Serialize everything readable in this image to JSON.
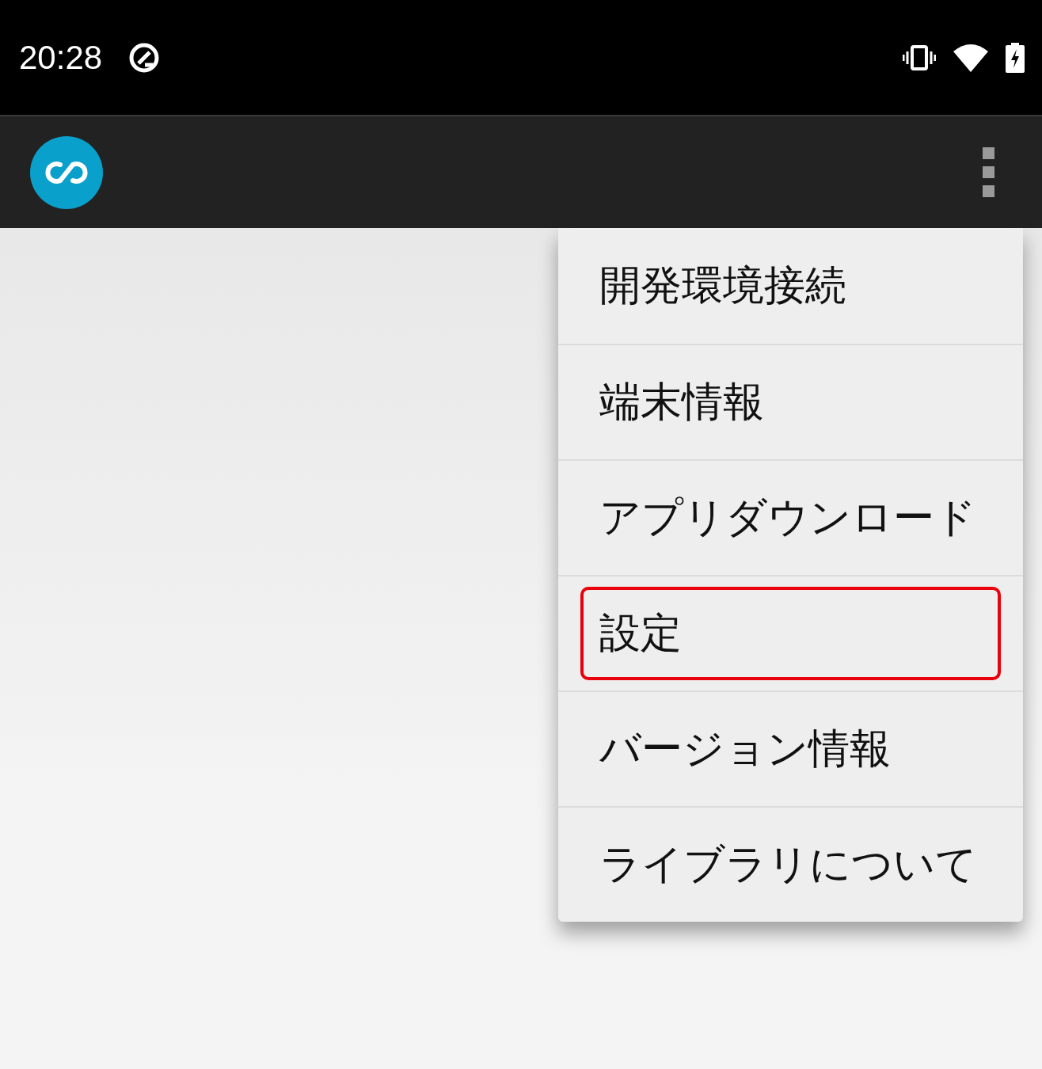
{
  "status_bar": {
    "time": "20:28"
  },
  "menu": {
    "items": [
      {
        "label": "開発環境接続",
        "highlighted": false
      },
      {
        "label": "端末情報",
        "highlighted": false
      },
      {
        "label": "アプリダウンロード",
        "highlighted": false
      },
      {
        "label": "設定",
        "highlighted": true
      },
      {
        "label": "バージョン情報",
        "highlighted": false
      },
      {
        "label": "ライブラリについて",
        "highlighted": false
      }
    ]
  }
}
